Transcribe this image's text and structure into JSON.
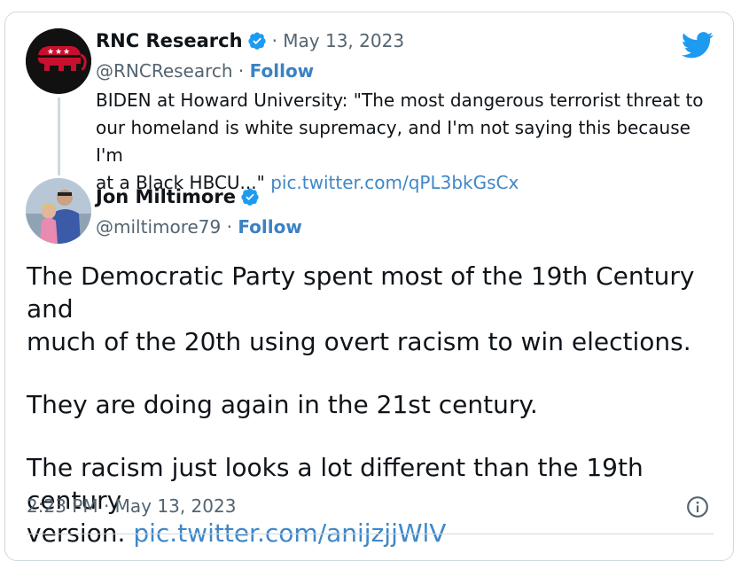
{
  "parent_tweet": {
    "author_name": "RNC Research",
    "date": "· May 13, 2023",
    "handle": "@RNCResearch",
    "separator": " · ",
    "follow_label": "Follow",
    "text_line1": "BIDEN at Howard University: \"The most dangerous terrorist threat to",
    "text_line2": "our homeland is white supremacy, and I'm not saying this because I'm",
    "text_line3": "at a Black HBCU...\" ",
    "link": "pic.twitter.com/qPL3bkGsCx"
  },
  "main_tweet": {
    "author_name": "Jon Miltimore",
    "handle": "@miltimore79",
    "separator": " · ",
    "follow_label": "Follow",
    "paragraph1_line1": "The Democratic Party spent most of the 19th Century and",
    "paragraph1_line2": "much of the 20th using overt racism to win elections.",
    "paragraph2": "They are doing again in the 21st century.",
    "paragraph3_line1": "The  racism just looks a lot different than the 19th century",
    "paragraph3_line2": "version. ",
    "link": "pic.twitter.com/anijzjjWlV",
    "timestamp": "2:23 PM · May 13, 2023"
  },
  "colors": {
    "twitter_blue": "#1d9bf0",
    "link_blue": "#3f87c8",
    "secondary_text": "#536471",
    "rnc_red": "#c8102e"
  },
  "icons": {
    "brand": "twitter-bird-icon",
    "verified": "verified-badge-icon",
    "info": "info-icon"
  }
}
